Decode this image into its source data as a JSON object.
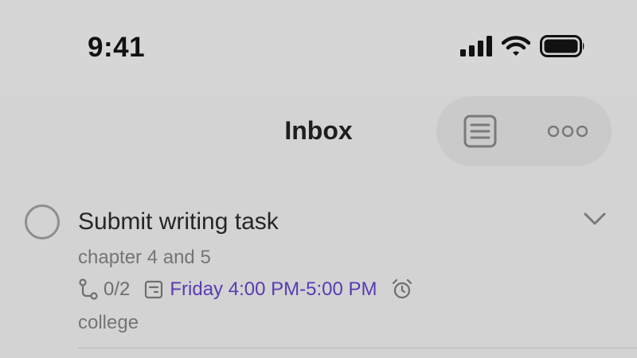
{
  "status_bar": {
    "time": "9:41",
    "icons": [
      "cellular-signal-icon",
      "wifi-icon",
      "battery-icon"
    ]
  },
  "header": {
    "title": "Inbox",
    "actions": [
      "list-view-icon",
      "more-options-icon"
    ]
  },
  "task": {
    "title": "Submit writing task",
    "description": "chapter 4 and 5",
    "subtasks": "0/2",
    "schedule": "Friday 4:00 PM-5:00 PM",
    "tag": "college",
    "completed": false
  },
  "colors": {
    "background": "#d3d3d3",
    "accent": "#5a3bb4",
    "text": "#262626",
    "muted": "#757575"
  }
}
